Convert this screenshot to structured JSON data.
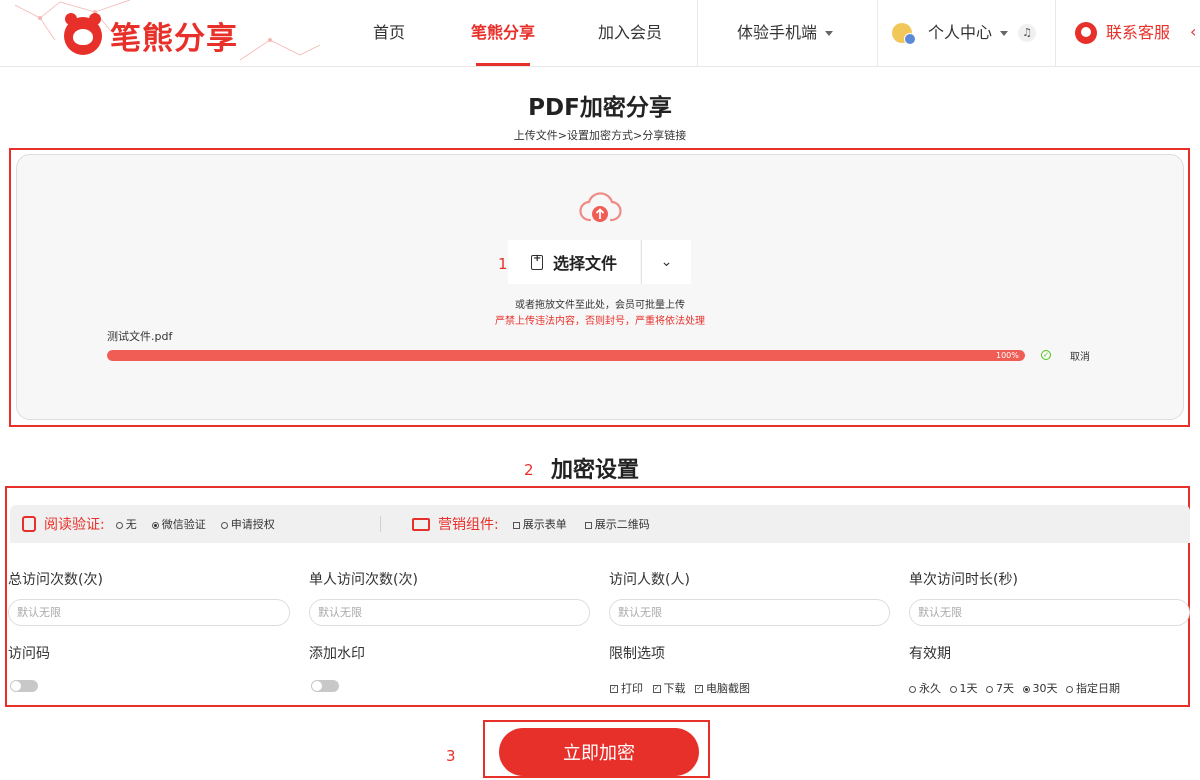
{
  "header": {
    "logo_text": "笔熊分享",
    "nav": {
      "home": "首页",
      "share": "笔熊分享",
      "member": "加入会员",
      "mobile": "体验手机端",
      "personal": "个人中心",
      "service": "联系客服"
    }
  },
  "page": {
    "title": "PDF加密分享",
    "steps": "上传文件>设置加密方式>分享链接"
  },
  "upload": {
    "annotation": "1",
    "choose_label": "选择文件",
    "drop_hint": "或者拖放文件至此处，会员可批量上传",
    "warning": "严禁上传违法内容，否则封号，严重将依法处理",
    "file_name": "测试文件.pdf",
    "progress": 100,
    "progress_text": "100%",
    "cancel_label": "取消"
  },
  "settings": {
    "annotation": "2",
    "title": "加密设置",
    "read_verify": {
      "title": "阅读验证:",
      "options": [
        "无",
        "微信验证",
        "申请授权"
      ],
      "selected": "微信验证"
    },
    "marketing": {
      "title": "营销组件:",
      "options": [
        "展示表单",
        "展示二维码"
      ]
    },
    "fields": {
      "total_visits": {
        "label": "总访问次数(次)",
        "placeholder": "默认无限",
        "value": ""
      },
      "single_visits": {
        "label": "单人访问次数(次)",
        "placeholder": "默认无限",
        "value": ""
      },
      "visitors": {
        "label": "访问人数(人)",
        "placeholder": "默认无限",
        "value": ""
      },
      "duration": {
        "label": "单次访问时长(秒)",
        "placeholder": "默认无限",
        "value": ""
      }
    },
    "access_code": {
      "label": "访问码",
      "enabled": false
    },
    "watermark": {
      "label": "添加水印",
      "enabled": false
    },
    "restrictions": {
      "label": "限制选项",
      "options": [
        "打印",
        "下载",
        "电脑截图"
      ]
    },
    "validity": {
      "label": "有效期",
      "options": [
        "永久",
        "1天",
        "7天",
        "30天",
        "指定日期"
      ],
      "selected": "30天"
    }
  },
  "submit": {
    "annotation": "3",
    "label": "立即加密"
  },
  "colors": {
    "brand_red": "#e8302a",
    "progress_fill": "#f05d55"
  }
}
